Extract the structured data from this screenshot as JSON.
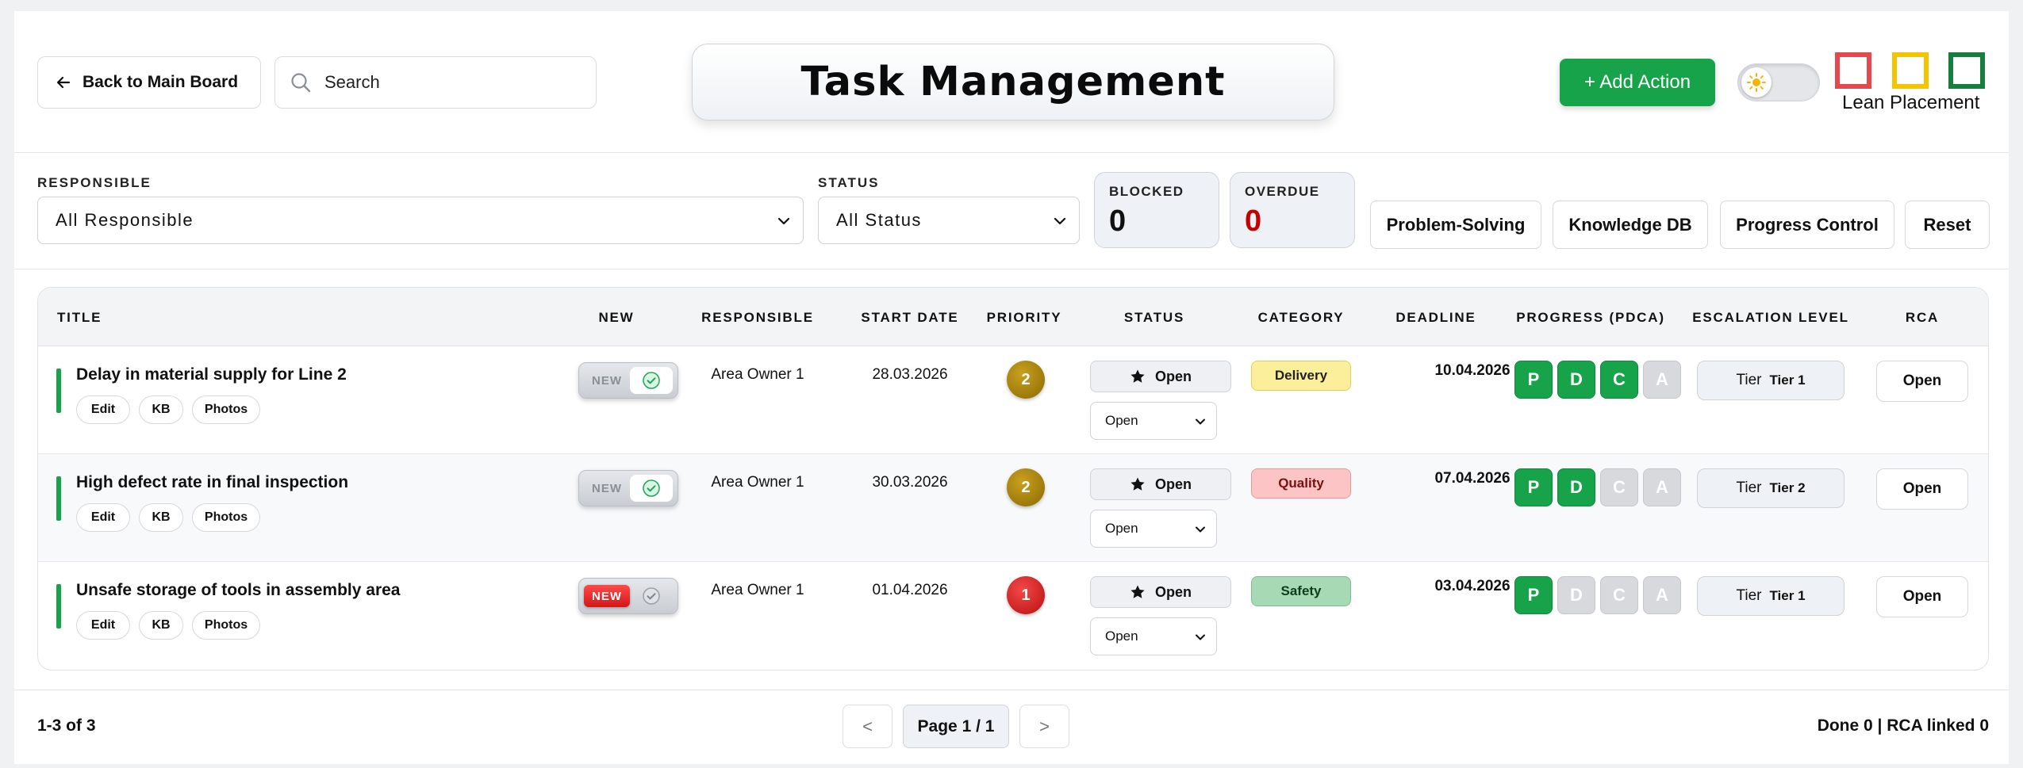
{
  "header": {
    "back_label": "Back to Main Board",
    "search_placeholder": "Search",
    "title": "Task Management",
    "add_action_label": "+ Add Action",
    "lean_label": "Lean Placement"
  },
  "colors": {
    "accent_green": "#16a34a",
    "lean_red": "#e5484d",
    "lean_yellow": "#f5c400",
    "lean_green": "#15803d",
    "overdue_red": "#c40000"
  },
  "filters": {
    "responsible_label": "RESPONSIBLE",
    "responsible_value": "All Responsible",
    "status_label": "STATUS",
    "status_value": "All Status",
    "blocked_label": "BLOCKED",
    "blocked_value": "0",
    "overdue_label": "OVERDUE",
    "overdue_value": "0",
    "buttons": [
      "Problem-Solving",
      "Knowledge DB",
      "Progress Control",
      "Reset"
    ]
  },
  "table": {
    "columns": [
      "TITLE",
      "NEW",
      "RESPONSIBLE",
      "START DATE",
      "PRIORITY",
      "STATUS",
      "CATEGORY",
      "DEADLINE",
      "PROGRESS (PDCA)",
      "ESCALATION LEVEL",
      "RCA"
    ],
    "row_actions": [
      "Edit",
      "KB",
      "Photos"
    ],
    "new_label": "NEW",
    "rows": [
      {
        "title": "Delay in material supply for Line 2",
        "responsible": "Area Owner 1",
        "start_date": "28.03.2026",
        "priority": "2",
        "status_pill": "Open",
        "status_select": "Open",
        "category": "Delivery",
        "deadline": "10.04.2026",
        "pdca": [
          "P",
          "D",
          "C",
          "A"
        ],
        "tier_prefix": "Tier",
        "tier": "Tier 1",
        "rca": "Open"
      },
      {
        "title": "High defect rate in final inspection",
        "responsible": "Area Owner 1",
        "start_date": "30.03.2026",
        "priority": "2",
        "status_pill": "Open",
        "status_select": "Open",
        "category": "Quality",
        "deadline": "07.04.2026",
        "pdca": [
          "P",
          "D",
          "C",
          "A"
        ],
        "tier_prefix": "Tier",
        "tier": "Tier 2",
        "rca": "Open"
      },
      {
        "title": "Unsafe storage of tools in assembly area",
        "responsible": "Area Owner 1",
        "start_date": "01.04.2026",
        "priority": "1",
        "status_pill": "Open",
        "status_select": "Open",
        "category": "Safety",
        "deadline": "03.04.2026",
        "pdca": [
          "P",
          "D",
          "C",
          "A"
        ],
        "tier_prefix": "Tier",
        "tier": "Tier 1",
        "rca": "Open"
      }
    ]
  },
  "footer": {
    "count": "1-3 of 3",
    "prev": "<",
    "page": "Page 1 / 1",
    "next": ">",
    "summary": "Done 0 | RCA linked 0"
  }
}
